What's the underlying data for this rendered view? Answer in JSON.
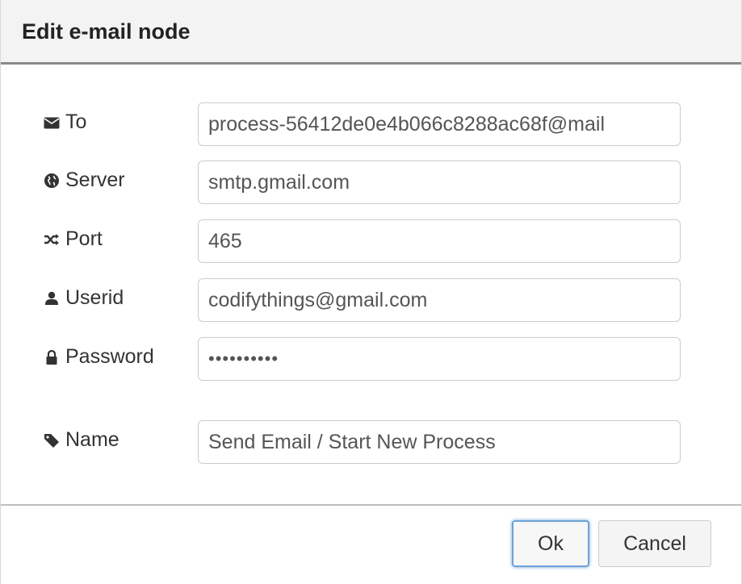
{
  "dialog": {
    "title": "Edit e-mail node"
  },
  "fields": {
    "to": {
      "label": "To",
      "icon": "envelope-icon",
      "value": "process-56412de0e4b066c8288ac68f@mail"
    },
    "server": {
      "label": "Server",
      "icon": "globe-icon",
      "value": "smtp.gmail.com"
    },
    "port": {
      "label": "Port",
      "icon": "shuffle-icon",
      "value": "465"
    },
    "userid": {
      "label": "Userid",
      "icon": "user-icon",
      "value": "codifythings@gmail.com"
    },
    "password": {
      "label": "Password",
      "icon": "lock-icon",
      "value": "••••••••••"
    },
    "name": {
      "label": "Name",
      "icon": "tag-icon",
      "value": "Send Email / Start New Process"
    }
  },
  "buttons": {
    "ok": "Ok",
    "cancel": "Cancel"
  },
  "colors": {
    "header_bg": "#f3f3f3",
    "ok_focus": "#6ea3d8"
  }
}
